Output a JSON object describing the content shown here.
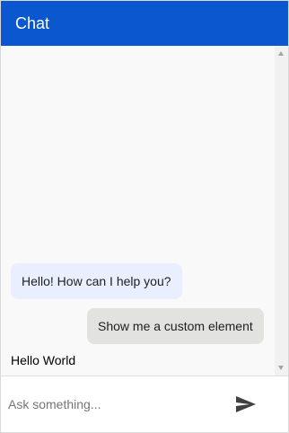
{
  "header": {
    "title": "Chat"
  },
  "messages": [
    {
      "role": "bot",
      "text": "Hello! How can I help you?"
    },
    {
      "role": "user",
      "text": "Show me a custom element"
    },
    {
      "role": "custom",
      "text": "Hello World"
    }
  ],
  "composer": {
    "placeholder": "Ask something...",
    "value": "",
    "send_icon": "send-icon"
  },
  "colors": {
    "header_bg": "#0b57d0",
    "bot_bubble": "#e9efff",
    "user_bubble": "#e2e3df",
    "messages_bg": "#f9f9f9"
  }
}
